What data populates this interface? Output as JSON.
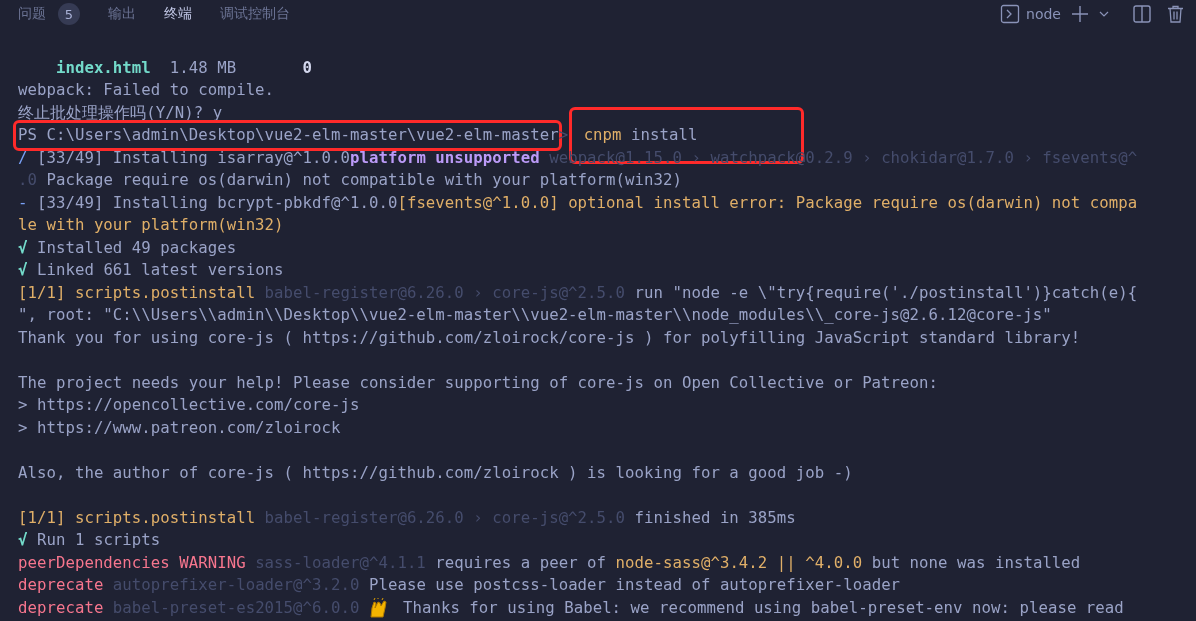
{
  "panel_tabs": [
    {
      "label": "问题",
      "badge": "5",
      "selected": false
    },
    {
      "label": "输出",
      "selected": false
    },
    {
      "label": "终端",
      "selected": true
    },
    {
      "label": "调试控制台",
      "selected": false
    }
  ],
  "terminal_toolbar": {
    "shell": "node"
  },
  "terminal_lines": [
    {
      "kind": "blank"
    },
    {
      "kind": "text",
      "segments": [
        {
          "text": "    index.html",
          "kind": "file"
        },
        {
          "text": "  1.48 MB       ",
          "kind": "plain"
        },
        {
          "text": "0",
          "kind": "bold"
        }
      ]
    },
    {
      "kind": "text",
      "segments": [
        {
          "text": "webpack: Failed to compile.",
          "kind": "plain"
        }
      ]
    },
    {
      "kind": "text",
      "segments": [
        {
          "text": "终止批处理操作吗(Y/N)? y",
          "kind": "plain"
        }
      ]
    },
    {
      "kind": "text",
      "segments": [
        {
          "text": "PS C:\\Users\\admin\\Desktop\\vue2-elm-master\\vue2-elm-master",
          "kind": "plain",
          "boxed": true
        },
        {
          "text": ">",
          "kind": "dim"
        },
        {
          "text": " cnpm",
          "kind": "yellow",
          "boxed": true
        },
        {
          "text": " install",
          "kind": "plain",
          "boxed": true
        }
      ]
    },
    {
      "kind": "text",
      "segments": [
        {
          "text": "/",
          "kind": "blue"
        },
        {
          "text": " [33/49] Installing isarray@^1.0.0",
          "kind": "plain"
        },
        {
          "text": "platform unsupported",
          "kind": "purple"
        },
        {
          "text": " webpack@1.15.0 › watchpack@0.2.9 › chokidar@1.7.0 › fsevents@^",
          "kind": "dim"
        }
      ]
    },
    {
      "kind": "text",
      "segments": [
        {
          "text": ".0",
          "kind": "dim"
        },
        {
          "text": " Package require os(darwin) not compatible with your platform(win32)",
          "kind": "plain"
        }
      ]
    },
    {
      "kind": "text",
      "segments": [
        {
          "text": "-",
          "kind": "blue"
        },
        {
          "text": " [33/49] Installing bcrypt-pbkdf@^1.0.0",
          "kind": "plain"
        },
        {
          "text": "[fsevents@^1.0.0] optional install error: Package require os(darwin) not compa",
          "kind": "yellow"
        }
      ]
    },
    {
      "kind": "text",
      "segments": [
        {
          "text": "le with your platform(win32)",
          "kind": "yellow"
        }
      ]
    },
    {
      "kind": "text",
      "segments": [
        {
          "text": "√",
          "kind": "check"
        },
        {
          "text": " Installed 49 packages",
          "kind": "plain"
        }
      ]
    },
    {
      "kind": "text",
      "segments": [
        {
          "text": "√",
          "kind": "check"
        },
        {
          "text": " Linked 661 latest versions",
          "kind": "plain"
        }
      ]
    },
    {
      "kind": "text",
      "segments": [
        {
          "text": "[1/1] scripts.postinstall",
          "kind": "yellow"
        },
        {
          "text": " babel-register@6.26.0 › core-js@^2.5.0",
          "kind": "dim"
        },
        {
          "text": " run \"node -e \\\"try{require('./postinstall')}catch(e){",
          "kind": "plain"
        }
      ]
    },
    {
      "kind": "text",
      "segments": [
        {
          "text": "\", root: \"C:\\\\Users\\\\admin\\\\Desktop\\\\vue2-elm-master\\\\vue2-elm-master\\\\node_modules\\\\_core-js@2.6.12@core-js\"",
          "kind": "plain"
        }
      ]
    },
    {
      "kind": "text",
      "segments": [
        {
          "text": "Thank you for using core-js ( https://github.com/zloirock/core-js ) for polyfilling JavaScript standard library!",
          "kind": "plain"
        }
      ]
    },
    {
      "kind": "blank"
    },
    {
      "kind": "text",
      "segments": [
        {
          "text": "The project needs your help! Please consider supporting of core-js on Open Collective or Patreon:",
          "kind": "plain"
        }
      ]
    },
    {
      "kind": "text",
      "segments": [
        {
          "text": "> https://opencollective.com/core-js",
          "kind": "plain"
        }
      ]
    },
    {
      "kind": "text",
      "segments": [
        {
          "text": "> https://www.patreon.com/zloirock",
          "kind": "plain"
        }
      ]
    },
    {
      "kind": "blank"
    },
    {
      "kind": "text",
      "segments": [
        {
          "text": "Also, the author of core-js ( https://github.com/zloirock ) is looking for a good job -)",
          "kind": "plain"
        }
      ]
    },
    {
      "kind": "blank"
    },
    {
      "kind": "text",
      "segments": [
        {
          "text": "[1/1] scripts.postinstall",
          "kind": "yellow"
        },
        {
          "text": " babel-register@6.26.0 › core-js@^2.5.0",
          "kind": "dim"
        },
        {
          "text": " finished in 385ms",
          "kind": "plain"
        }
      ]
    },
    {
      "kind": "text",
      "segments": [
        {
          "text": "√",
          "kind": "check"
        },
        {
          "text": " Run 1 scripts",
          "kind": "plain"
        }
      ]
    },
    {
      "kind": "text",
      "segments": [
        {
          "text": "peerDependencies WARNING",
          "kind": "red"
        },
        {
          "text": " sass-loader@^4.1.1",
          "kind": "dim"
        },
        {
          "text": " requires a peer of ",
          "kind": "plain"
        },
        {
          "text": "node-sass@^3.4.2 || ^4.0.0",
          "kind": "yellow"
        },
        {
          "text": " but none was installed",
          "kind": "plain"
        }
      ]
    },
    {
      "kind": "text",
      "segments": [
        {
          "text": "deprecate",
          "kind": "red"
        },
        {
          "text": " autoprefixer-loader@^3.2.0",
          "kind": "dim"
        },
        {
          "text": " Please use postcss-loader instead of autoprefixer-loader",
          "kind": "plain"
        }
      ]
    },
    {
      "kind": "text",
      "segments": [
        {
          "text": "deprecate",
          "kind": "red"
        },
        {
          "text": " babel-preset-es2015@^6.0.0",
          "kind": "dim"
        },
        {
          "kind": "emoji"
        },
        {
          "text": " Thanks for using Babel: we recommend using babel-preset-env now: please read",
          "kind": "plain"
        }
      ]
    }
  ]
}
